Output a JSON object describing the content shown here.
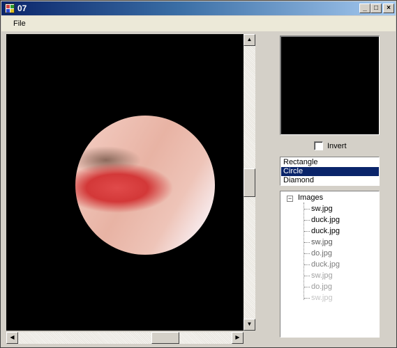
{
  "window": {
    "title": "07"
  },
  "menu": {
    "file_label": "File"
  },
  "titlebar_buttons": {
    "minimize": "_",
    "maximize": "□",
    "close": "×"
  },
  "scroll": {
    "up": "▲",
    "down": "▼",
    "left": "◀",
    "right": "▶"
  },
  "invert": {
    "label": "Invert",
    "checked": false
  },
  "shape_list": {
    "items": [
      "Rectangle",
      "Circle",
      "Diamond"
    ],
    "selected": "Circle"
  },
  "tree": {
    "toggle": "−",
    "root_label": "Images",
    "children": [
      {
        "label": "sw.jpg",
        "color": "#000000"
      },
      {
        "label": "duck.jpg",
        "color": "#000000"
      },
      {
        "label": "duck.jpg",
        "color": "#000000"
      },
      {
        "label": "sw.jpg",
        "color": "#555555"
      },
      {
        "label": "do.jpg",
        "color": "#6e6e6e"
      },
      {
        "label": "duck.jpg",
        "color": "#7c7c7c"
      },
      {
        "label": "sw.jpg",
        "color": "#a0a0a0"
      },
      {
        "label": "do.jpg",
        "color": "#9a9a9a"
      },
      {
        "label": "sw.jpg",
        "color": "#c4c4c4"
      }
    ]
  }
}
